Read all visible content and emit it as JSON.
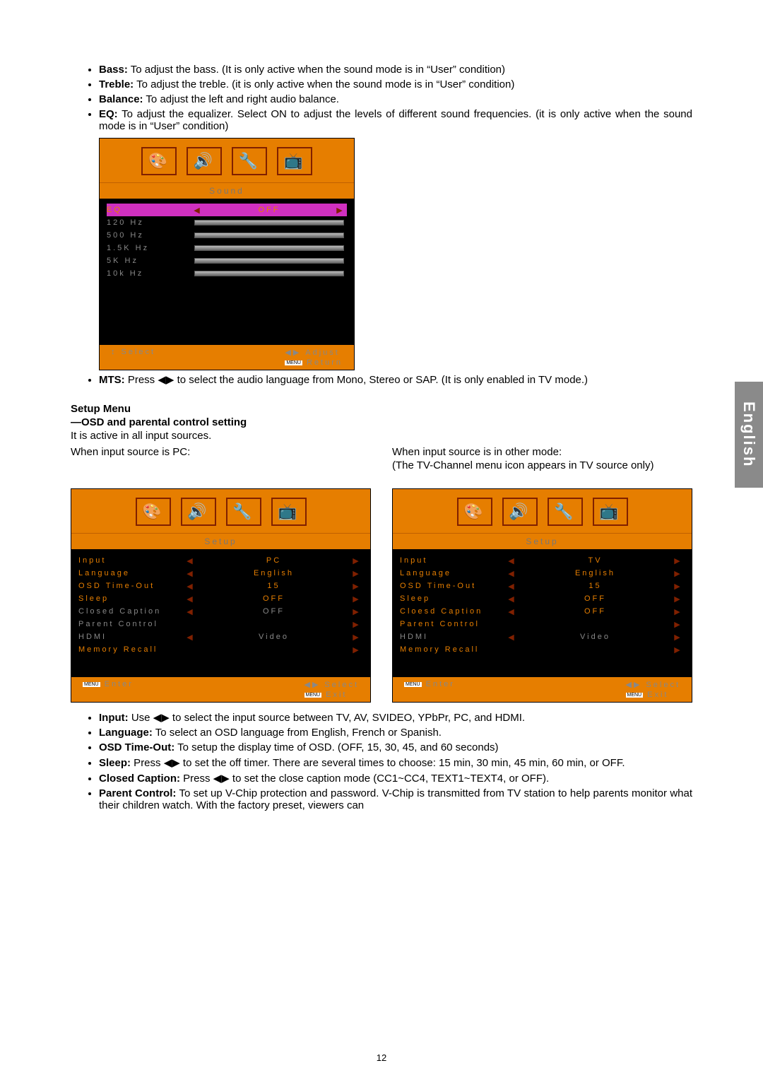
{
  "sideTab": "English",
  "pageNumber": "12",
  "topBullets": [
    {
      "term": "Bass:",
      "desc": " To adjust the bass. (It is only active when the sound mode is in “User” condition)"
    },
    {
      "term": "Treble:",
      "desc": " To adjust the treble. (it is only active when the sound mode is in “User” condition)"
    },
    {
      "term": "Balance:",
      "desc": " To adjust the left and right audio balance."
    },
    {
      "term": "EQ:",
      "desc": " To adjust the equalizer. Select ON to adjust the levels of different sound frequencies. (it is only active when the sound mode is in “User” condition)"
    }
  ],
  "eqMenu": {
    "title": "Sound",
    "highlight": {
      "label": "EQ",
      "value": "OFF"
    },
    "rows": [
      {
        "label": "120 Hz"
      },
      {
        "label": "500 Hz"
      },
      {
        "label": "1.5K Hz"
      },
      {
        "label": "5K  Hz"
      },
      {
        "label": "10k Hz"
      }
    ],
    "footer": {
      "selectIcon": "↕",
      "select": "Select",
      "adjustIcon": "◀▶",
      "adjust": "Adjust",
      "returnBadge": "MENU",
      "return": "Return"
    }
  },
  "mts": {
    "term": "MTS:",
    "desc": " Press ◀▶ to select the audio language from Mono, Stereo or SAP. (It is only enabled in TV mode.)"
  },
  "setupHead": "Setup Menu",
  "setupSub": "—OSD and parental control setting",
  "setupIntro": "It is active in all input sources.",
  "leftCaption": "When input source is PC:",
  "rightCaption": "When input source is in other mode:",
  "rightCaption2": "(The TV-Channel menu icon appears in TV source only)",
  "setupMenuPC": {
    "title": "Setup",
    "rows": [
      {
        "label": "Input",
        "value": "PC",
        "active": true,
        "arrows": true
      },
      {
        "label": "Language",
        "value": "English",
        "active": true,
        "arrows": true
      },
      {
        "label": "OSD Time-Out",
        "value": "15",
        "active": true,
        "arrows": true
      },
      {
        "label": "Sleep",
        "value": "OFF",
        "active": true,
        "arrows": true
      },
      {
        "label": "Closed Caption",
        "value": "OFF",
        "active": false,
        "arrows": true
      },
      {
        "label": "Parent Control",
        "value": "",
        "active": false,
        "arrows": false,
        "rightArrow": true
      },
      {
        "label": "HDMI",
        "value": "Video",
        "active": false,
        "arrows": true
      },
      {
        "label": "Memory Recall",
        "value": "",
        "active": true,
        "arrows": false,
        "rightArrow": true
      }
    ],
    "footer": {
      "enterBadge": "MENU",
      "enter": "Enter",
      "selectIcon": "◀▶",
      "select": "Select",
      "exitBadge": "MENU",
      "exit": "Exit"
    }
  },
  "setupMenuTV": {
    "title": "Setup",
    "rows": [
      {
        "label": "Input",
        "value": "TV",
        "active": true,
        "arrows": true
      },
      {
        "label": "Language",
        "value": "English",
        "active": true,
        "arrows": true
      },
      {
        "label": "OSD Time-Out",
        "value": "15",
        "active": true,
        "arrows": true
      },
      {
        "label": "Sleep",
        "value": "OFF",
        "active": true,
        "arrows": true
      },
      {
        "label": "Cloesd Caption",
        "value": "OFF",
        "active": true,
        "arrows": true
      },
      {
        "label": "Parent Control",
        "value": "",
        "active": true,
        "arrows": false,
        "rightArrow": true
      },
      {
        "label": "HDMI",
        "value": "Video",
        "active": false,
        "arrows": true
      },
      {
        "label": "Memory Recall",
        "value": "",
        "active": true,
        "arrows": false,
        "rightArrow": true
      }
    ],
    "footer": {
      "enterBadge": "MENU",
      "enter": "Enter",
      "selectIcon": "◀▶",
      "select": "Select",
      "exitBadge": "MENU",
      "exit": "Exit"
    }
  },
  "bottomBullets": [
    {
      "term": "Input:",
      "desc": " Use ◀▶ to select the input source between TV, AV, SVIDEO, YPbPr, PC, and HDMI."
    },
    {
      "term": "Language:",
      "desc": " To select an OSD language from English, French or Spanish."
    },
    {
      "term": "OSD Time-Out:",
      "desc": " To setup the display time of OSD. (OFF, 15, 30, 45, and 60 seconds)"
    },
    {
      "term": "Sleep:",
      "desc": " Press ◀▶ to set the off timer. There are several times to choose: 15 min, 30 min, 45 min, 60 min, or OFF."
    },
    {
      "term": "Closed Caption:",
      "desc": " Press ◀▶ to set the close caption mode (CC1~CC4, TEXT1~TEXT4, or OFF)."
    },
    {
      "term": "Parent Control:",
      "desc": " To set up V-Chip protection and password. V-Chip is transmitted from TV station to help parents monitor what their children watch. With the factory preset, viewers can"
    }
  ],
  "icons": {
    "picture": "🎨",
    "sound": "🔊",
    "setup": "🔧",
    "tv": "📺"
  }
}
